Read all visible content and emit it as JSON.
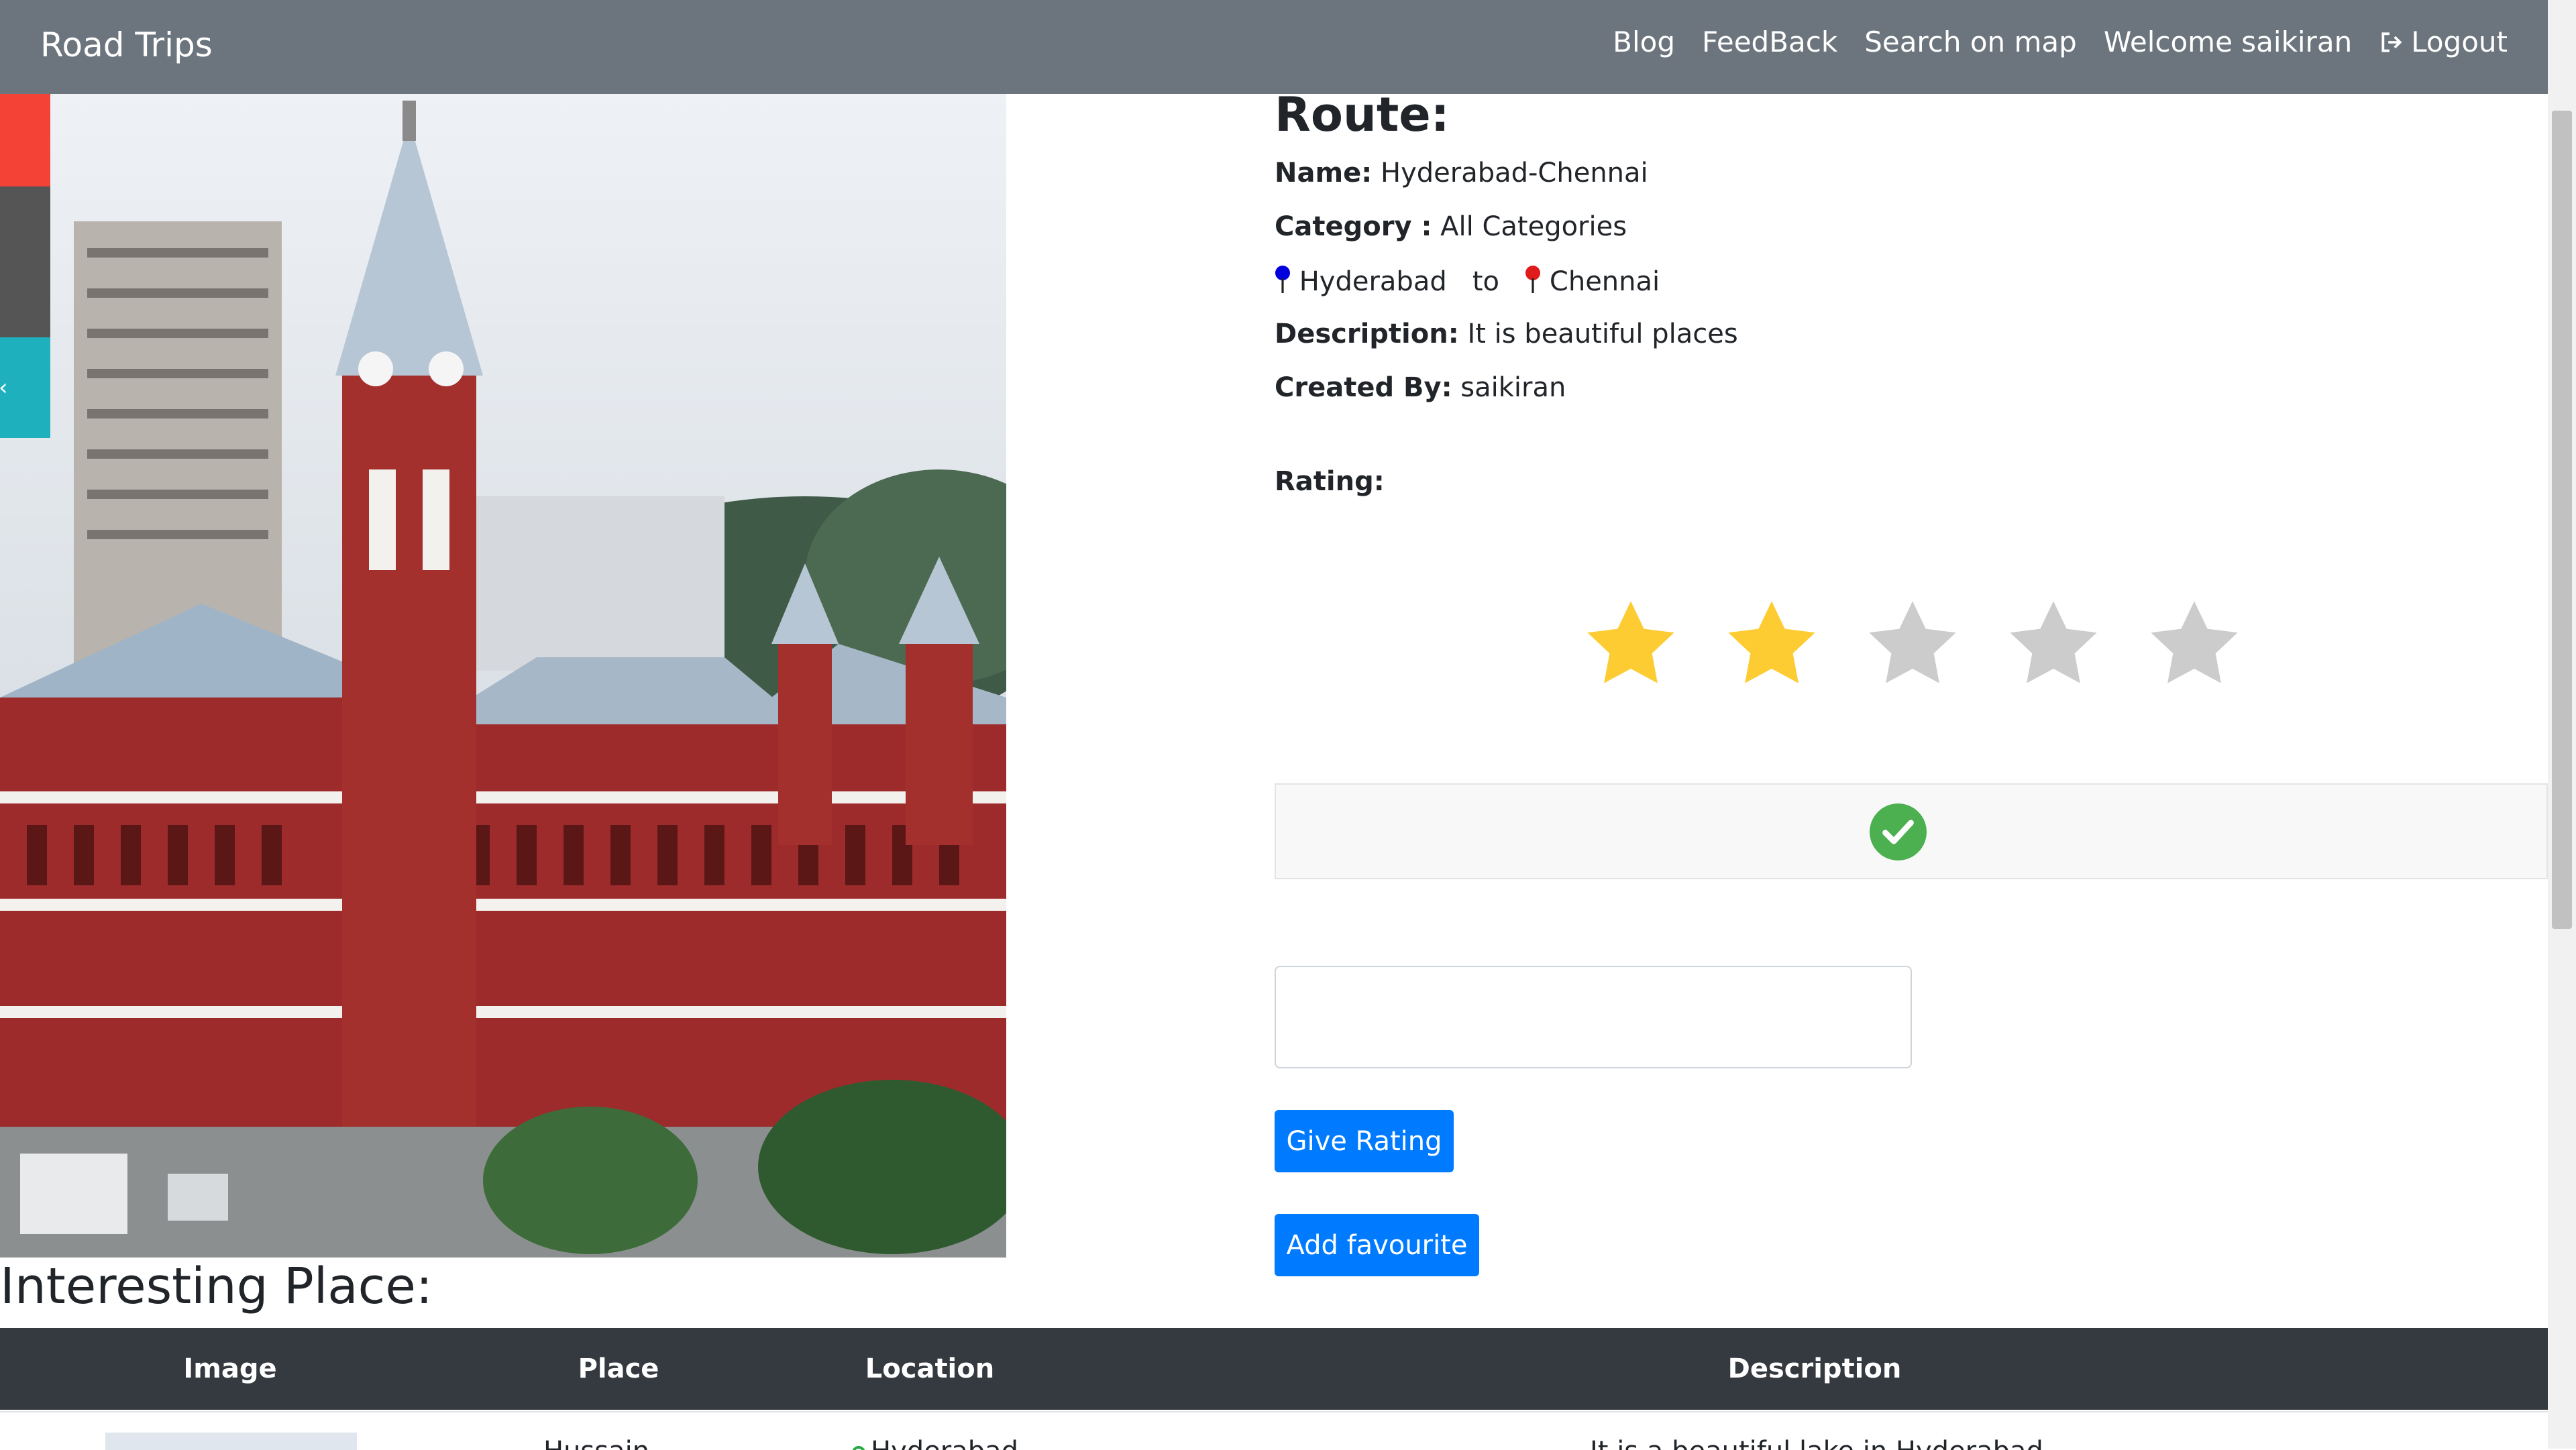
{
  "navbar": {
    "brand": "Road Trips",
    "links": {
      "blog": "Blog",
      "feedback": "FeedBack",
      "search_map": "Search on map",
      "welcome": "Welcome saikiran",
      "logout": "Logout"
    }
  },
  "route": {
    "title": "Route:",
    "name_label": "Name:",
    "name_value": "Hyderabad-Chennai",
    "category_label": "Category :",
    "category_value": "All Categories",
    "from": "Hyderabad",
    "to_word": "to",
    "to": "Chennai",
    "description_label": "Description:",
    "description_value": "It is beautiful places",
    "created_by_label": "Created By:",
    "created_by_value": "saikiran",
    "rating_label": "Rating:",
    "rating_value": 2,
    "rating_max": 5
  },
  "colors": {
    "navbar": "#6c757d",
    "star_filled": "#fdcc33",
    "star_empty": "#cccccc",
    "primary": "#007bff",
    "success": "#4caf50",
    "table_head": "#343a40"
  },
  "actions": {
    "give_rating": "Give Rating",
    "add_favourite": "Add favourite"
  },
  "places": {
    "title": "Interesting Place:",
    "columns": [
      "Image",
      "Place",
      "Location",
      "Description"
    ],
    "rows": [
      {
        "place": "Hussain...",
        "location": "Hyderabad",
        "description": "It is a beautiful lake in Hyderabad"
      }
    ]
  }
}
